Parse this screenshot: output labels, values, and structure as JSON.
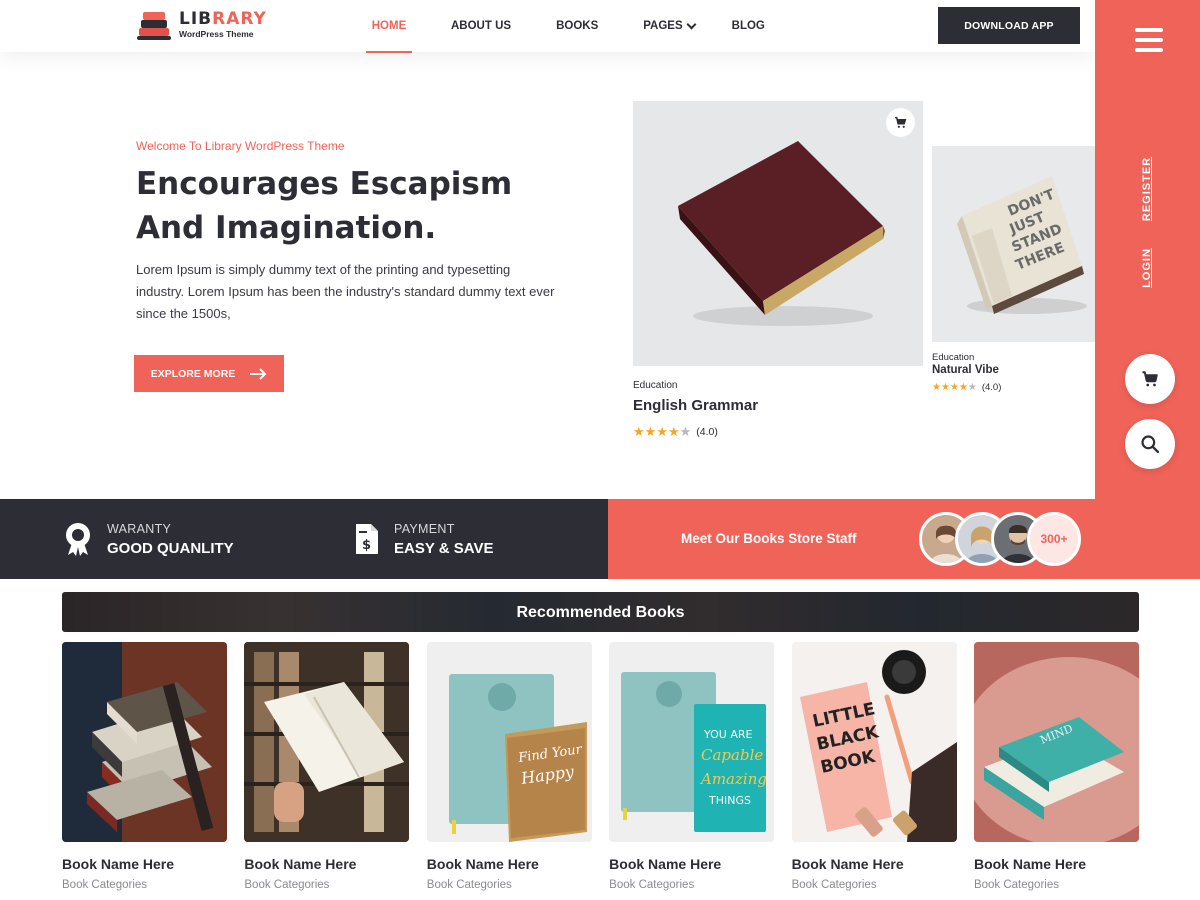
{
  "header": {
    "logo_title_a": "LIB",
    "logo_title_b": "RARY",
    "logo_sub": "WordPress Theme",
    "nav": [
      {
        "label": "HOME",
        "active": true
      },
      {
        "label": "ABOUT US",
        "active": false
      },
      {
        "label": "BOOKS",
        "active": false
      },
      {
        "label": "PAGES",
        "active": false,
        "dropdown": true
      },
      {
        "label": "BLOG",
        "active": false
      }
    ],
    "download_label": "DOWNLOAD APP"
  },
  "sidebar": {
    "register_label": "REGISTER",
    "login_label": "LOGIN",
    "icons": [
      "hamburger-icon",
      "cart-icon",
      "search-icon"
    ]
  },
  "hero": {
    "subtitle": "Welcome To Library WordPress Theme",
    "title_line1": "Encourages Escapism",
    "title_line2": "And Imagination.",
    "text": "Lorem Ipsum is simply dummy text of the printing and typesetting industry. Lorem Ipsum has been the industry's standard dummy text ever since the 1500s,",
    "button_label": "EXPLORE MORE"
  },
  "hero_products": [
    {
      "category": "Education",
      "name": "English Grammar",
      "rating_text": "(4.0)",
      "rating": 4
    },
    {
      "category": "Education",
      "name": "Natural Vibe",
      "rating_text": "(4.0)",
      "rating": 4
    }
  ],
  "features": [
    {
      "label": "WARANTY",
      "value": "GOOD QUANLITY",
      "icon": "award-icon"
    },
    {
      "label": "PAYMENT",
      "value": "EASY & SAVE",
      "icon": "payment-document-icon"
    }
  ],
  "staff": {
    "text": "Meet Our Books Store Staff",
    "count": "300+"
  },
  "recommended": {
    "title": "Recommended Books",
    "books": [
      {
        "name": "Book Name Here",
        "category": "Book Categories"
      },
      {
        "name": "Book Name Here",
        "category": "Book Categories"
      },
      {
        "name": "Book Name Here",
        "category": "Book Categories"
      },
      {
        "name": "Book Name Here",
        "category": "Book Categories"
      },
      {
        "name": "Book Name Here",
        "category": "Book Categories"
      },
      {
        "name": "Book Name Here",
        "category": "Book Categories"
      }
    ]
  },
  "colors": {
    "accent": "#f06359",
    "dark": "#2d2d35",
    "star": "#f6a623"
  }
}
